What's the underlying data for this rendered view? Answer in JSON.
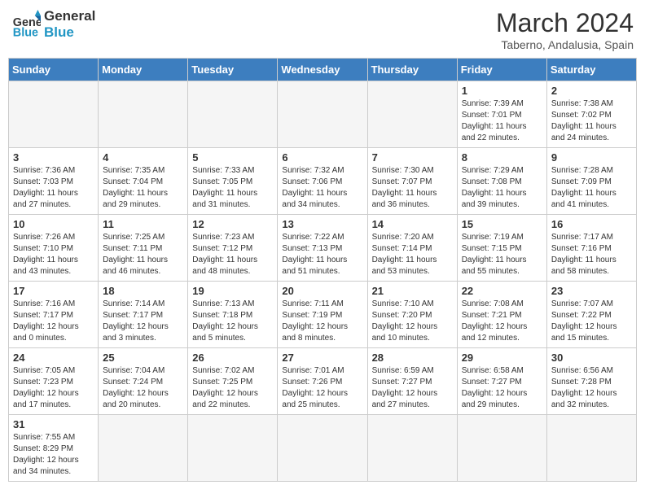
{
  "header": {
    "logo_general": "General",
    "logo_blue": "Blue",
    "month_title": "March 2024",
    "subtitle": "Taberno, Andalusia, Spain"
  },
  "weekdays": [
    "Sunday",
    "Monday",
    "Tuesday",
    "Wednesday",
    "Thursday",
    "Friday",
    "Saturday"
  ],
  "weeks": [
    [
      {
        "day": "",
        "info": ""
      },
      {
        "day": "",
        "info": ""
      },
      {
        "day": "",
        "info": ""
      },
      {
        "day": "",
        "info": ""
      },
      {
        "day": "",
        "info": ""
      },
      {
        "day": "1",
        "info": "Sunrise: 7:39 AM\nSunset: 7:01 PM\nDaylight: 11 hours and 22 minutes."
      },
      {
        "day": "2",
        "info": "Sunrise: 7:38 AM\nSunset: 7:02 PM\nDaylight: 11 hours and 24 minutes."
      }
    ],
    [
      {
        "day": "3",
        "info": "Sunrise: 7:36 AM\nSunset: 7:03 PM\nDaylight: 11 hours and 27 minutes."
      },
      {
        "day": "4",
        "info": "Sunrise: 7:35 AM\nSunset: 7:04 PM\nDaylight: 11 hours and 29 minutes."
      },
      {
        "day": "5",
        "info": "Sunrise: 7:33 AM\nSunset: 7:05 PM\nDaylight: 11 hours and 31 minutes."
      },
      {
        "day": "6",
        "info": "Sunrise: 7:32 AM\nSunset: 7:06 PM\nDaylight: 11 hours and 34 minutes."
      },
      {
        "day": "7",
        "info": "Sunrise: 7:30 AM\nSunset: 7:07 PM\nDaylight: 11 hours and 36 minutes."
      },
      {
        "day": "8",
        "info": "Sunrise: 7:29 AM\nSunset: 7:08 PM\nDaylight: 11 hours and 39 minutes."
      },
      {
        "day": "9",
        "info": "Sunrise: 7:28 AM\nSunset: 7:09 PM\nDaylight: 11 hours and 41 minutes."
      }
    ],
    [
      {
        "day": "10",
        "info": "Sunrise: 7:26 AM\nSunset: 7:10 PM\nDaylight: 11 hours and 43 minutes."
      },
      {
        "day": "11",
        "info": "Sunrise: 7:25 AM\nSunset: 7:11 PM\nDaylight: 11 hours and 46 minutes."
      },
      {
        "day": "12",
        "info": "Sunrise: 7:23 AM\nSunset: 7:12 PM\nDaylight: 11 hours and 48 minutes."
      },
      {
        "day": "13",
        "info": "Sunrise: 7:22 AM\nSunset: 7:13 PM\nDaylight: 11 hours and 51 minutes."
      },
      {
        "day": "14",
        "info": "Sunrise: 7:20 AM\nSunset: 7:14 PM\nDaylight: 11 hours and 53 minutes."
      },
      {
        "day": "15",
        "info": "Sunrise: 7:19 AM\nSunset: 7:15 PM\nDaylight: 11 hours and 55 minutes."
      },
      {
        "day": "16",
        "info": "Sunrise: 7:17 AM\nSunset: 7:16 PM\nDaylight: 11 hours and 58 minutes."
      }
    ],
    [
      {
        "day": "17",
        "info": "Sunrise: 7:16 AM\nSunset: 7:17 PM\nDaylight: 12 hours and 0 minutes."
      },
      {
        "day": "18",
        "info": "Sunrise: 7:14 AM\nSunset: 7:17 PM\nDaylight: 12 hours and 3 minutes."
      },
      {
        "day": "19",
        "info": "Sunrise: 7:13 AM\nSunset: 7:18 PM\nDaylight: 12 hours and 5 minutes."
      },
      {
        "day": "20",
        "info": "Sunrise: 7:11 AM\nSunset: 7:19 PM\nDaylight: 12 hours and 8 minutes."
      },
      {
        "day": "21",
        "info": "Sunrise: 7:10 AM\nSunset: 7:20 PM\nDaylight: 12 hours and 10 minutes."
      },
      {
        "day": "22",
        "info": "Sunrise: 7:08 AM\nSunset: 7:21 PM\nDaylight: 12 hours and 12 minutes."
      },
      {
        "day": "23",
        "info": "Sunrise: 7:07 AM\nSunset: 7:22 PM\nDaylight: 12 hours and 15 minutes."
      }
    ],
    [
      {
        "day": "24",
        "info": "Sunrise: 7:05 AM\nSunset: 7:23 PM\nDaylight: 12 hours and 17 minutes."
      },
      {
        "day": "25",
        "info": "Sunrise: 7:04 AM\nSunset: 7:24 PM\nDaylight: 12 hours and 20 minutes."
      },
      {
        "day": "26",
        "info": "Sunrise: 7:02 AM\nSunset: 7:25 PM\nDaylight: 12 hours and 22 minutes."
      },
      {
        "day": "27",
        "info": "Sunrise: 7:01 AM\nSunset: 7:26 PM\nDaylight: 12 hours and 25 minutes."
      },
      {
        "day": "28",
        "info": "Sunrise: 6:59 AM\nSunset: 7:27 PM\nDaylight: 12 hours and 27 minutes."
      },
      {
        "day": "29",
        "info": "Sunrise: 6:58 AM\nSunset: 7:27 PM\nDaylight: 12 hours and 29 minutes."
      },
      {
        "day": "30",
        "info": "Sunrise: 6:56 AM\nSunset: 7:28 PM\nDaylight: 12 hours and 32 minutes."
      }
    ],
    [
      {
        "day": "31",
        "info": "Sunrise: 7:55 AM\nSunset: 8:29 PM\nDaylight: 12 hours and 34 minutes."
      },
      {
        "day": "",
        "info": ""
      },
      {
        "day": "",
        "info": ""
      },
      {
        "day": "",
        "info": ""
      },
      {
        "day": "",
        "info": ""
      },
      {
        "day": "",
        "info": ""
      },
      {
        "day": "",
        "info": ""
      }
    ]
  ]
}
